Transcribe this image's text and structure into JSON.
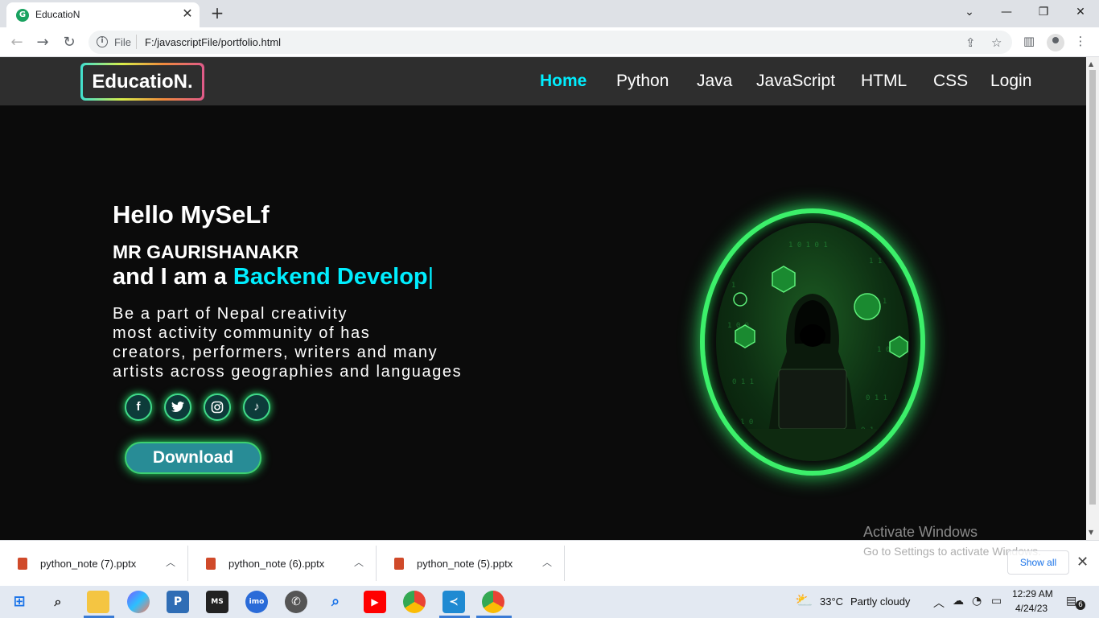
{
  "browser": {
    "tab_title": "EducatioN",
    "favicon_letter": "G",
    "file_label": "File",
    "url": "F:/javascriptFile/portfolio.html"
  },
  "site": {
    "logo": "EducatioN.",
    "nav": [
      "Home",
      "Python",
      "Java",
      "JavaScript",
      "HTML",
      "CSS",
      "Login"
    ],
    "active_nav": "Home"
  },
  "hero": {
    "greeting": "Hello MySeLf",
    "name": "MR GAURISHANAKR",
    "intro_prefix": "and I am a ",
    "role_typed": "Backend Develop",
    "cursor": "|",
    "bio": [
      "Be a part of Nepal creativity",
      "most activity community of has",
      "creators, performers, writers and many",
      "artists across geographies and languages"
    ],
    "socials": [
      "facebook-icon",
      "twitter-icon",
      "instagram-icon",
      "tiktok-icon"
    ],
    "download_label": "Download"
  },
  "downloads": {
    "items": [
      "python_note (7).pptx",
      "python_note (6).pptx",
      "python_note (5).pptx"
    ],
    "show_all": "Show all"
  },
  "watermark": {
    "title": "Activate Windows",
    "subtitle": "Go to Settings to activate Windows."
  },
  "taskbar": {
    "weather_temp": "33°C",
    "weather_desc": "Partly cloudy",
    "time": "12:29 AM",
    "date": "4/24/23",
    "notification_count": "6"
  },
  "colors": {
    "accent": "#00eeff",
    "glow": "#3cf06a",
    "page_bg": "#0b0b0b",
    "nav_bg": "#2e2e2e"
  }
}
